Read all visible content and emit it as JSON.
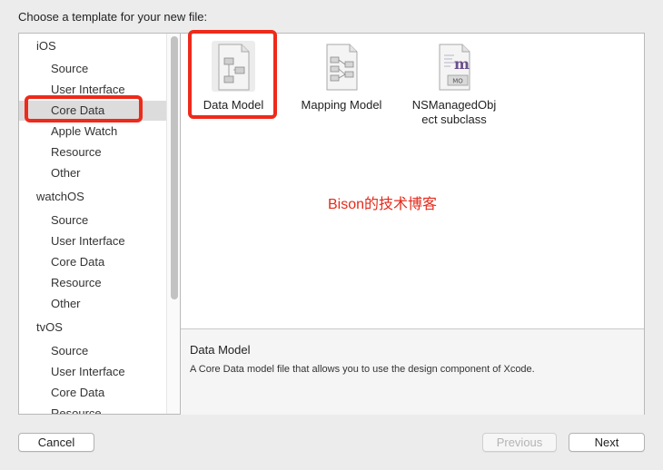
{
  "heading": "Choose a template for your new file:",
  "sidebar": {
    "platforms": [
      {
        "label": "iOS",
        "items": [
          "Source",
          "User Interface",
          "Core Data",
          "Apple Watch",
          "Resource",
          "Other"
        ]
      },
      {
        "label": "watchOS",
        "items": [
          "Source",
          "User Interface",
          "Core Data",
          "Resource",
          "Other"
        ]
      },
      {
        "label": "tvOS",
        "items": [
          "Source",
          "User Interface",
          "Core Data",
          "Resource"
        ]
      }
    ],
    "selected": "Core Data"
  },
  "templates": [
    {
      "label": "Data Model",
      "icon": "data-model-icon",
      "selected": true
    },
    {
      "label": "Mapping Model",
      "icon": "mapping-model-icon",
      "selected": false
    },
    {
      "label": "NSManagedObj\nect subclass",
      "icon": "managed-object-icon",
      "badge": "MO",
      "selected": false
    }
  ],
  "watermark": "Bison的技术博客",
  "description": {
    "title": "Data Model",
    "text": "A Core Data model file that allows you to use the design component of Xcode."
  },
  "buttons": {
    "cancel": "Cancel",
    "previous": "Previous",
    "next": "Next"
  },
  "colors": {
    "highlight": "#ee2a1b",
    "watermark": "#e42a1b",
    "selection": "#dcdcdc"
  }
}
